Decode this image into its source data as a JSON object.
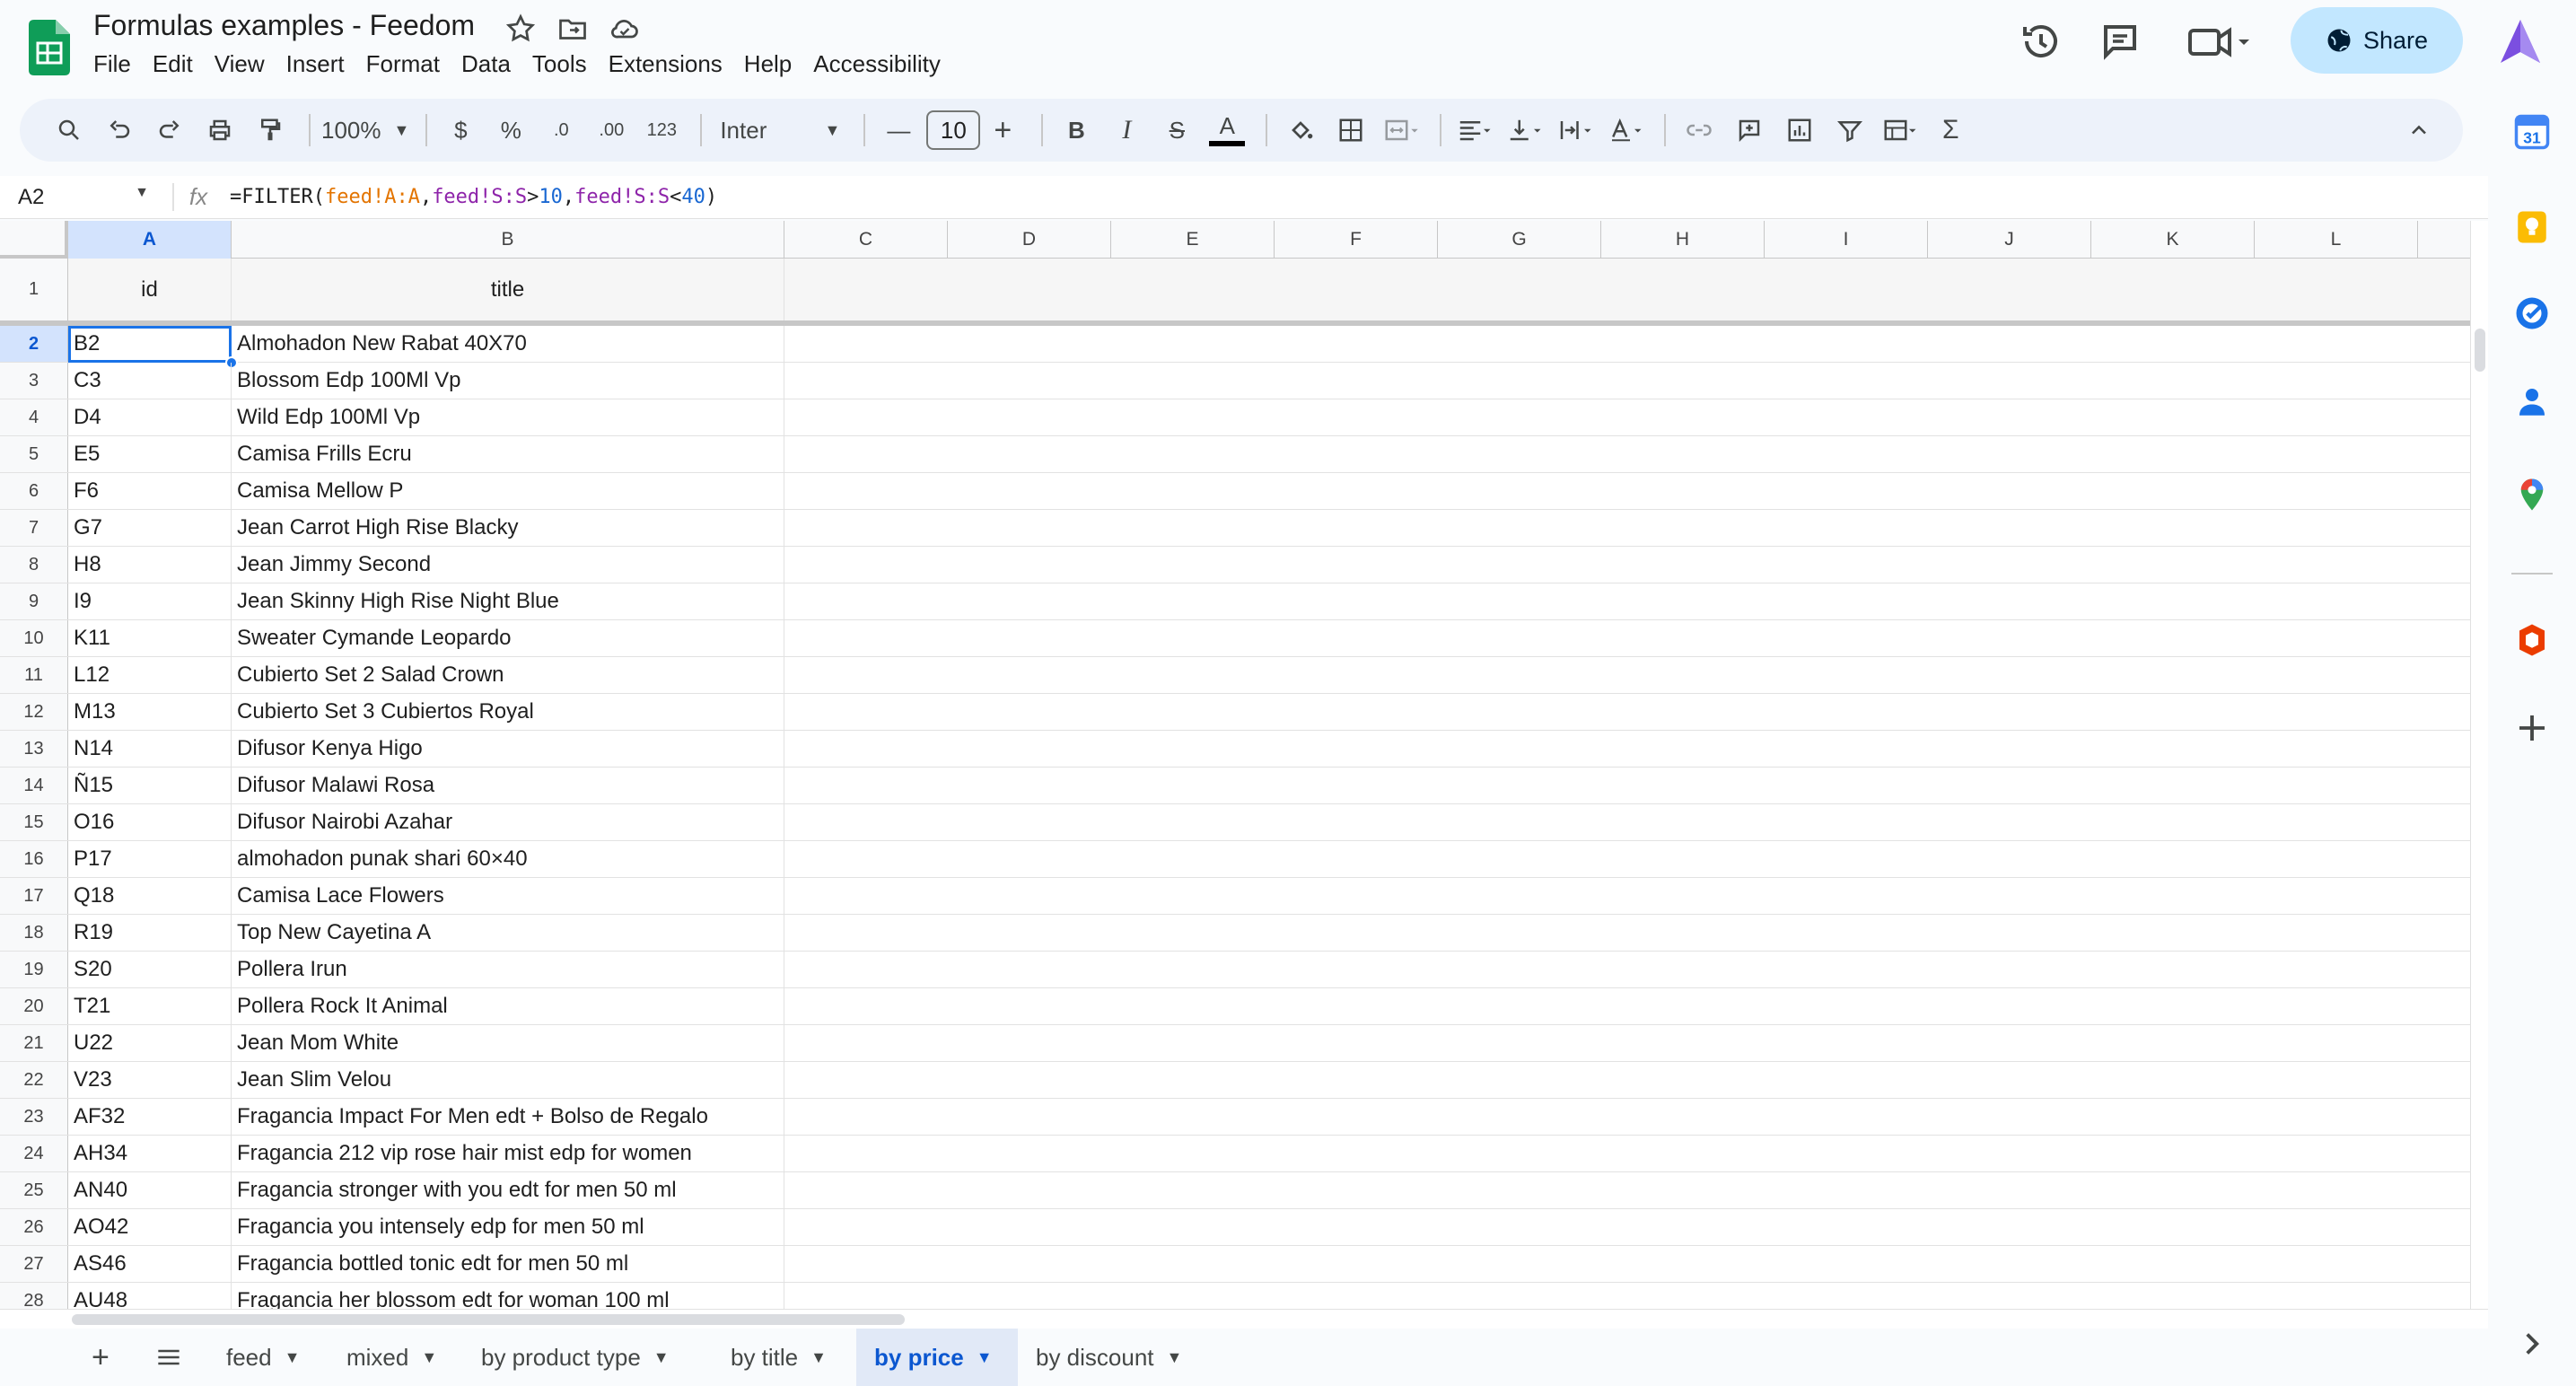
{
  "title": {
    "doc_name": "Formulas examples - Feedom"
  },
  "menu": [
    "File",
    "Edit",
    "View",
    "Insert",
    "Format",
    "Data",
    "Tools",
    "Extensions",
    "Help",
    "Accessibility"
  ],
  "share_label": "Share",
  "toolbar": {
    "zoom": "100%",
    "currency": "$",
    "percent": "%",
    "dec_decrease": ".0",
    "dec_increase": ".00",
    "number_format": "123",
    "font": "Inter",
    "font_size": "10",
    "bold": "B",
    "italic": "I",
    "strike": "S",
    "text_color": "A",
    "sum": "Σ"
  },
  "formula_bar": {
    "cell_ref": "A2",
    "fx": "fx"
  },
  "formula_parts": {
    "p1": "=FILTER(",
    "p2": "feed!A:A",
    "p3": ",",
    "p4": "feed!S:S",
    "p5": ">",
    "p6": "10",
    "p7": ",",
    "p8": "feed!S:S",
    "p9": "<",
    "p10": "40",
    "p11": ")"
  },
  "columns": [
    "A",
    "B",
    "C",
    "D",
    "E",
    "F",
    "G",
    "H",
    "I",
    "J",
    "K",
    "L"
  ],
  "header_row": {
    "num": "1",
    "a": "id",
    "b": "title"
  },
  "rows": [
    {
      "num": "2",
      "id": "B2",
      "title": "Almohadon New Rabat 40X70"
    },
    {
      "num": "3",
      "id": "C3",
      "title": "Blossom Edp 100Ml Vp"
    },
    {
      "num": "4",
      "id": "D4",
      "title": "Wild Edp 100Ml Vp"
    },
    {
      "num": "5",
      "id": "E5",
      "title": "Camisa Frills Ecru"
    },
    {
      "num": "6",
      "id": "F6",
      "title": "Camisa Mellow P"
    },
    {
      "num": "7",
      "id": "G7",
      "title": "Jean Carrot High Rise Blacky"
    },
    {
      "num": "8",
      "id": "H8",
      "title": "Jean Jimmy Second"
    },
    {
      "num": "9",
      "id": "I9",
      "title": "Jean Skinny High Rise Night Blue"
    },
    {
      "num": "10",
      "id": "K11",
      "title": "Sweater Cymande Leopardo"
    },
    {
      "num": "11",
      "id": "L12",
      "title": "Cubierto Set 2 Salad Crown"
    },
    {
      "num": "12",
      "id": "M13",
      "title": "Cubierto Set 3 Cubiertos Royal"
    },
    {
      "num": "13",
      "id": "N14",
      "title": "Difusor Kenya Higo"
    },
    {
      "num": "14",
      "id": "Ñ15",
      "title": "Difusor Malawi Rosa"
    },
    {
      "num": "15",
      "id": "O16",
      "title": "Difusor Nairobi Azahar"
    },
    {
      "num": "16",
      "id": "P17",
      "title": "almohadon punak shari 60×40"
    },
    {
      "num": "17",
      "id": "Q18",
      "title": "Camisa Lace Flowers"
    },
    {
      "num": "18",
      "id": "R19",
      "title": "Top New Cayetina A"
    },
    {
      "num": "19",
      "id": "S20",
      "title": "Pollera Irun"
    },
    {
      "num": "20",
      "id": "T21",
      "title": "Pollera Rock It Animal"
    },
    {
      "num": "21",
      "id": "U22",
      "title": "Jean Mom White"
    },
    {
      "num": "22",
      "id": "V23",
      "title": "Jean Slim Velou"
    },
    {
      "num": "23",
      "id": "AF32",
      "title": "Fragancia Impact For Men edt + Bolso de Regalo"
    },
    {
      "num": "24",
      "id": "AH34",
      "title": "Fragancia 212 vip rose hair mist edp for women"
    },
    {
      "num": "25",
      "id": "AN40",
      "title": "Fragancia stronger with you edt for men 50 ml"
    },
    {
      "num": "26",
      "id": "AO42",
      "title": "Fragancia you intensely edp for men 50 ml"
    },
    {
      "num": "27",
      "id": "AS46",
      "title": "Fragancia bottled tonic edt for men 50 ml"
    },
    {
      "num": "28",
      "id": "AU48",
      "title": "Fragancia her blossom edt for woman 100 ml"
    }
  ],
  "sheet_tabs": [
    "feed",
    "mixed",
    "by product type",
    "by title",
    "by price",
    "by discount"
  ],
  "active_tab": "by price",
  "colors": {
    "accent": "#1a73e8",
    "share_bg": "#c2e7ff",
    "toolbar_bg": "#edf2fa",
    "sheets_green": "#0f9d58"
  }
}
